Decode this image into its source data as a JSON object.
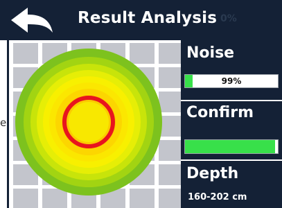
{
  "header": {
    "title": "Result Analysis",
    "ghost_text": "0%",
    "back_icon": "back-arrow-icon"
  },
  "scan": {
    "side_label": "e",
    "target_marker_color": "#e8141e",
    "ring_colors": [
      "#7dc21e",
      "#a2d412",
      "#c8e40a",
      "#e6ee06",
      "#f8f000",
      "#fbe700",
      "#fcd600",
      "#fbcb00",
      "#f8e800"
    ]
  },
  "noise": {
    "label": "Noise",
    "value_text": "99%",
    "fill_fraction": 0.08
  },
  "confirm": {
    "label": "Confirm",
    "fill_fraction": 0.97
  },
  "depth": {
    "label": "Depth",
    "value": "160-202 cm"
  },
  "colors": {
    "navy": "#142136",
    "bar_green": "#38e04a",
    "grid_gray": "#c3c5cc"
  }
}
